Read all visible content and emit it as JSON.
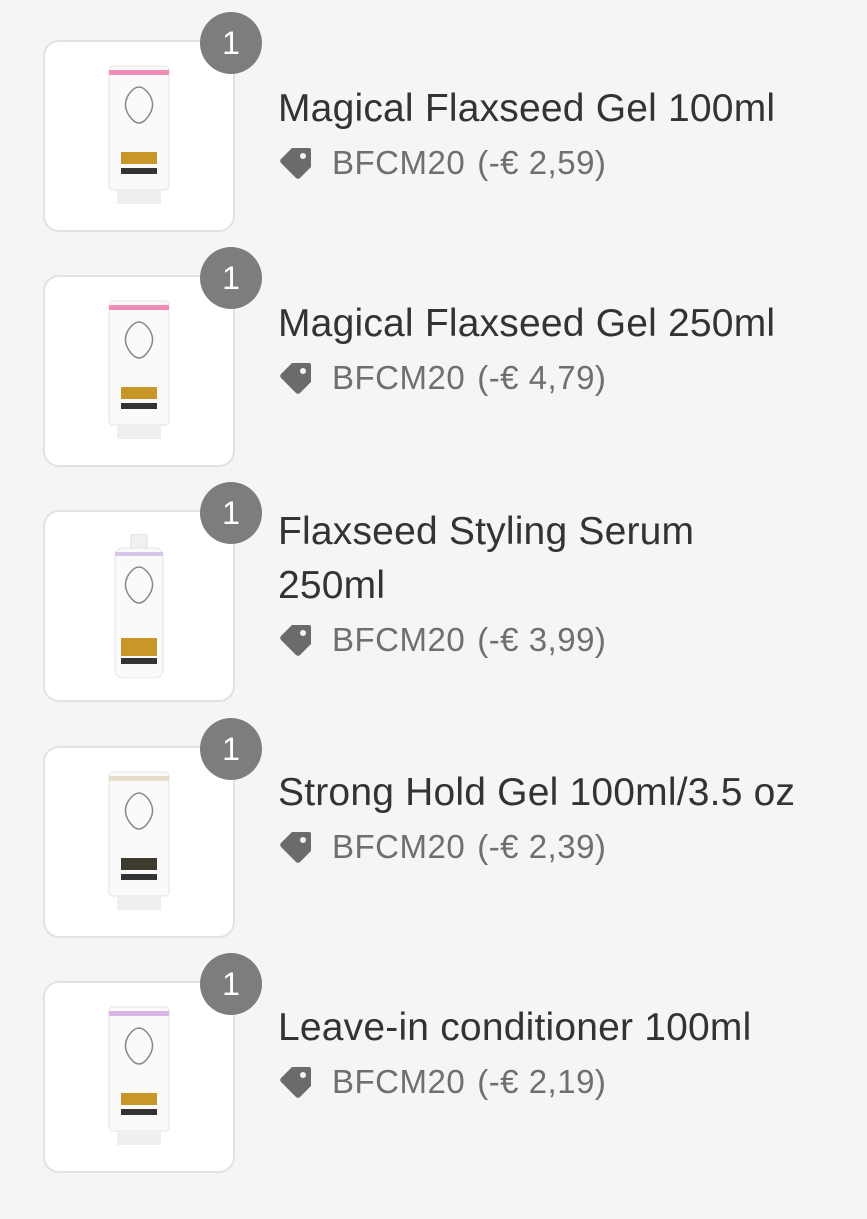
{
  "items": [
    {
      "quantity": "1",
      "title": "Magical Flaxseed Gel 100ml",
      "discount_code": "BFCM20",
      "discount_amount": "(-€ 2,59)",
      "accent": "#f28bb5",
      "label_color": "#c9962a",
      "package": "tube"
    },
    {
      "quantity": "1",
      "title": "Magical Flaxseed Gel 250ml",
      "discount_code": "BFCM20",
      "discount_amount": "(-€ 4,79)",
      "accent": "#f28bb5",
      "label_color": "#c9962a",
      "package": "tube"
    },
    {
      "quantity": "1",
      "title": "Flaxseed Styling Serum 250ml",
      "discount_code": "BFCM20",
      "discount_amount": "(-€ 3,99)",
      "accent": "#d8c6e8",
      "label_color": "#c9962a",
      "package": "bottle"
    },
    {
      "quantity": "1",
      "title": "Strong Hold Gel 100ml/3.5 oz",
      "discount_code": "BFCM20",
      "discount_amount": "(-€ 2,39)",
      "accent": "#e8dccb",
      "label_color": "#3f3b2e",
      "package": "tube"
    },
    {
      "quantity": "1",
      "title": "Leave-in conditioner 100ml",
      "discount_code": "BFCM20",
      "discount_amount": "(-€ 2,19)",
      "accent": "#d9b6e6",
      "label_color": "#c9962a",
      "package": "tube"
    }
  ],
  "icons": {
    "discount": "tag-icon",
    "product": "product-thumbnail"
  },
  "colors": {
    "background": "#f5f5f5",
    "badge": "#7d7d7d",
    "title": "#333333",
    "discount_text": "#6f6f6f",
    "tag": "#6b6b6b"
  }
}
